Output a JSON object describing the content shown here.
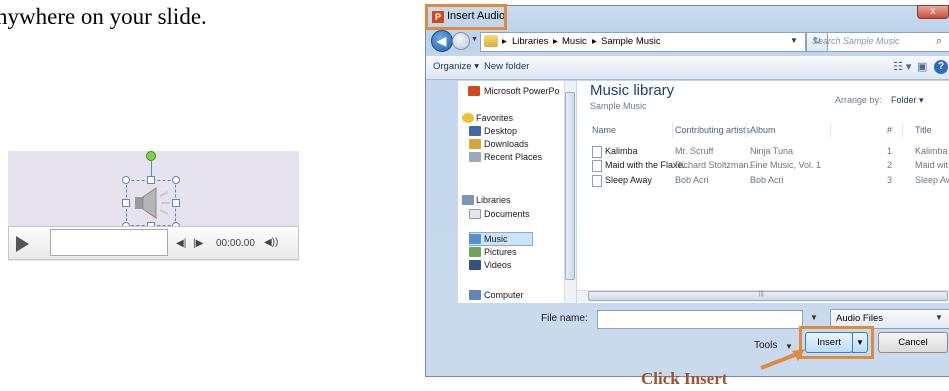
{
  "slide": {
    "instruction_fragment": "nywhere on your slide."
  },
  "audio_player": {
    "time": "00:00.00"
  },
  "dialog": {
    "title": "Insert Audio",
    "title_icon": "P",
    "close_label": "x",
    "breadcrumb": [
      "Libraries",
      "Music",
      "Sample Music"
    ],
    "search_placeholder": "Search Sample Music",
    "toolbar": {
      "organize": "Organize",
      "new_folder": "New folder"
    },
    "nav": {
      "top_item": "Microsoft PowerPo",
      "favorites": "Favorites",
      "favorites_items": [
        "Desktop",
        "Downloads",
        "Recent Places"
      ],
      "libraries": "Libraries",
      "libraries_items": [
        "Documents",
        "Music",
        "Pictures",
        "Videos"
      ],
      "computer": "Computer"
    },
    "library": {
      "title": "Music library",
      "subtitle": "Sample Music",
      "arrange_label": "Arrange by:",
      "arrange_value": "Folder"
    },
    "columns": [
      "Name",
      "Contributing artists",
      "Album",
      "#",
      "Title"
    ],
    "files": [
      {
        "name": "Kalimba",
        "artist": "Mr. Scruff",
        "album": "Ninja Tuna",
        "track": "1",
        "title": "Kalimba"
      },
      {
        "name": "Maid with the Flaxe...",
        "artist": "Richard Stoltzman...",
        "album": "Fine Music, Vol. 1",
        "track": "2",
        "title": "Maid wit"
      },
      {
        "name": "Sleep Away",
        "artist": "Bob Acri",
        "album": "Bob Acri",
        "track": "3",
        "title": "Sleep Aw"
      }
    ],
    "file_name_label": "File name:",
    "file_name_value": "",
    "file_type": "Audio Files",
    "tools_label": "Tools",
    "insert_label": "Insert",
    "cancel_label": "Cancel"
  },
  "caption": "Click Insert",
  "colors": {
    "highlight": "#e08a3d",
    "caption": "#a0522d",
    "library_title": "#1e3e76"
  }
}
